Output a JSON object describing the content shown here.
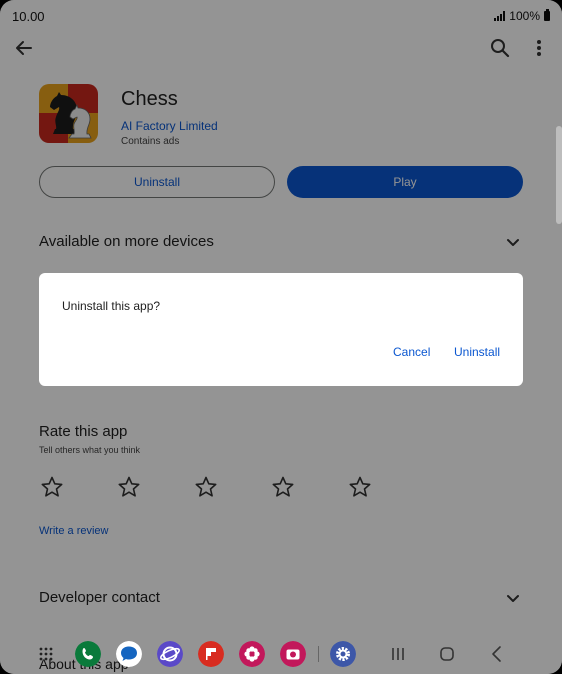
{
  "status_bar": {
    "time": "10.00",
    "battery": "100%"
  },
  "app_bar": {
    "back_icon": "arrow-left-icon",
    "search_icon": "search-icon",
    "more_icon": "more-vert-icon"
  },
  "app": {
    "title": "Chess",
    "developer": "AI Factory Limited",
    "ads_note": "Contains ads",
    "icon": "chess-knight-icon",
    "icon_colors": [
      "#c8281e",
      "#e8a21c"
    ]
  },
  "actions": {
    "uninstall_label": "Uninstall",
    "play_label": "Play"
  },
  "sections": {
    "more_devices": "Available on more devices",
    "rate_title": "Rate this app",
    "rate_subtitle": "Tell others what you think",
    "write_review": "Write a review",
    "developer_contact": "Developer contact",
    "next_row": "About this app"
  },
  "rating": {
    "stars_total": 5,
    "stars_selected": 0
  },
  "dialog": {
    "message": "Uninstall this app?",
    "cancel_label": "Cancel",
    "confirm_label": "Uninstall"
  },
  "taskbar": {
    "apps": [
      "apps-grid-icon",
      "phone-icon",
      "messages-icon",
      "internet-icon",
      "flipboard-icon",
      "gallery-icon",
      "camera-icon",
      "settings-icon"
    ],
    "nav": [
      "recents-icon",
      "home-icon",
      "back-icon"
    ]
  },
  "colors": {
    "accent": "#0b57d0",
    "scrim": "rgba(0,0,0,0.42)"
  }
}
